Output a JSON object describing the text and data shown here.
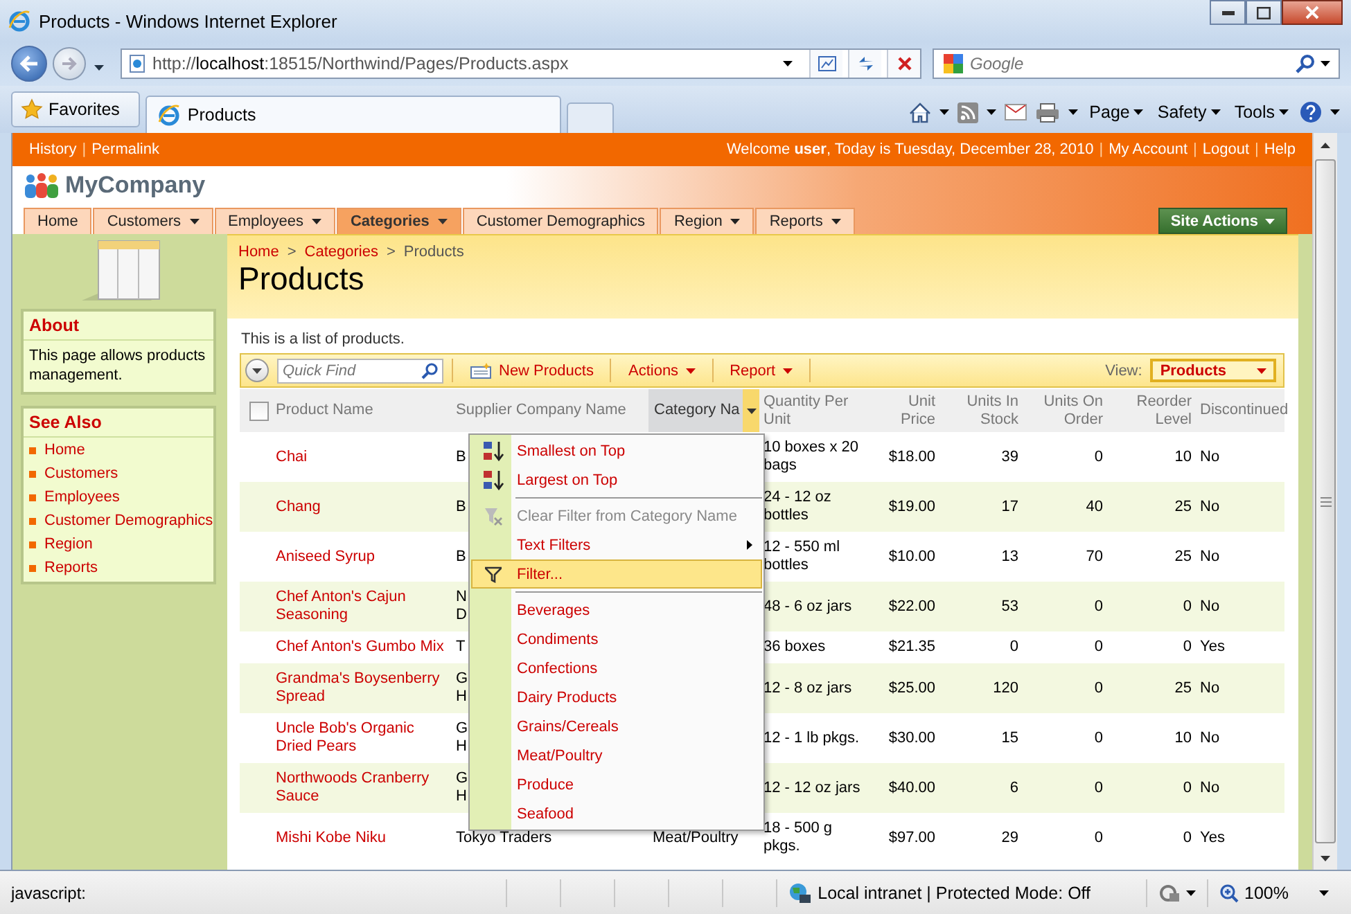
{
  "browser": {
    "title": "Products - Windows Internet Explorer",
    "address": "http://**localhost**:18515/Northwind/Pages/Products.aspx",
    "search_placeholder": "Google",
    "favorites": "Favorites",
    "tab": "Products",
    "commands": [
      "Page",
      "Safety",
      "Tools"
    ]
  },
  "top_links": [
    "History",
    "Permalink"
  ],
  "link_separator": "|",
  "breadcrumb_separator": ">",
  "welcome": "Welcome **user**, Today is Tuesday, December 28, 2010",
  "account_links": [
    "My Account",
    "Logout",
    "Help"
  ],
  "brand": "MyCompany",
  "nav": [
    {
      "label": "Home",
      "has_menu": false,
      "selected": false
    },
    {
      "label": "Customers",
      "has_menu": true,
      "selected": false
    },
    {
      "label": "Employees",
      "has_menu": true,
      "selected": false
    },
    {
      "label": "Categories",
      "has_menu": true,
      "selected": true
    },
    {
      "label": "Customer Demographics",
      "has_menu": false,
      "selected": false
    },
    {
      "label": "Region",
      "has_menu": true,
      "selected": false
    },
    {
      "label": "Reports",
      "has_menu": true,
      "selected": false
    }
  ],
  "site_actions": "Site Actions",
  "sidebar": {
    "about": {
      "title": "About",
      "text": "This page allows products management."
    },
    "see_also": {
      "title": "See Also",
      "links": [
        "Home",
        "Customers",
        "Employees",
        "Customer Demographics",
        "Region",
        "Reports"
      ]
    }
  },
  "breadcrumb": [
    {
      "label": "Home",
      "kind": "link"
    },
    {
      "label": "Categories",
      "kind": "link"
    },
    {
      "label": "Products",
      "kind": "current"
    }
  ],
  "page_title": "Products",
  "description": "This is a list of products.",
  "toolbar": {
    "quick_find_placeholder": "Quick Find",
    "buttons": [
      {
        "label": "New Products",
        "kind": "new"
      },
      {
        "label": "Actions",
        "kind": "menu"
      },
      {
        "label": "Report",
        "kind": "menu"
      }
    ],
    "view_label": "View:",
    "view": "Products"
  },
  "table": {
    "select_all_checked": false,
    "columns": [
      {
        "label": "Product Name",
        "kind": "text",
        "menu_open": false
      },
      {
        "label": "Supplier Company Name",
        "kind": "text",
        "menu_open": false
      },
      {
        "label": "Category Na",
        "kind": "text",
        "menu_open": true
      },
      {
        "label": "Quantity Per Unit",
        "kind": "text",
        "menu_open": false
      },
      {
        "label": "Unit Price",
        "kind": "number",
        "menu_open": false
      },
      {
        "label": "Units In Stock",
        "kind": "number",
        "menu_open": false
      },
      {
        "label": "Units On Order",
        "kind": "number",
        "menu_open": false
      },
      {
        "label": "Reorder Level",
        "kind": "number",
        "menu_open": false
      },
      {
        "label": "Discontinued",
        "kind": "text",
        "menu_open": false
      }
    ],
    "rows": [
      {
        "cells": [
          "Chai",
          "B",
          "",
          "10 boxes x 20 bags",
          "$18.00",
          "39",
          "0",
          "10",
          "No"
        ]
      },
      {
        "cells": [
          "Chang",
          "B",
          "",
          "24 - 12 oz bottles",
          "$19.00",
          "17",
          "40",
          "25",
          "No"
        ]
      },
      {
        "cells": [
          "Aniseed Syrup",
          "B",
          "",
          "12 - 550 ml bottles",
          "$10.00",
          "13",
          "70",
          "25",
          "No"
        ]
      },
      {
        "cells": [
          "Chef Anton's Cajun Seasoning",
          "N\nD",
          "",
          "48 - 6 oz jars",
          "$22.00",
          "53",
          "0",
          "0",
          "No"
        ]
      },
      {
        "cells": [
          "Chef Anton's Gumbo Mix",
          "T",
          "",
          "36 boxes",
          "$21.35",
          "0",
          "0",
          "0",
          "Yes"
        ]
      },
      {
        "cells": [
          "Grandma's Boysenberry Spread",
          "G\nH",
          "",
          "12 - 8 oz jars",
          "$25.00",
          "120",
          "0",
          "25",
          "No"
        ]
      },
      {
        "cells": [
          "Uncle Bob's Organic Dried Pears",
          "G\nH",
          "",
          "12 - 1 lb pkgs.",
          "$30.00",
          "15",
          "0",
          "10",
          "No"
        ]
      },
      {
        "cells": [
          "Northwoods Cranberry Sauce",
          "G\nH",
          "",
          "12 - 12 oz jars",
          "$40.00",
          "6",
          "0",
          "0",
          "No"
        ]
      },
      {
        "cells": [
          "Mishi Kobe Niku",
          "Tokyo Traders",
          "Meat/Poultry",
          "18 - 500 g pkgs.",
          "$97.00",
          "29",
          "0",
          "0",
          "Yes"
        ]
      }
    ]
  },
  "column_menu": [
    {
      "label": "Smallest on Top",
      "kind": "sort-asc",
      "disabled": false,
      "selected": false
    },
    {
      "label": "Largest on Top",
      "kind": "sort-desc",
      "disabled": false,
      "selected": false
    },
    {
      "kind": "separator"
    },
    {
      "label": "Clear Filter from Category Name",
      "kind": "clear-filter",
      "disabled": true,
      "selected": false
    },
    {
      "label": "Text Filters",
      "kind": "submenu",
      "disabled": false,
      "selected": false
    },
    {
      "label": "Filter...",
      "kind": "filter",
      "disabled": false,
      "selected": true
    },
    {
      "kind": "separator"
    },
    {
      "label": "Beverages",
      "kind": "value",
      "disabled": false,
      "selected": false
    },
    {
      "label": "Condiments",
      "kind": "value",
      "disabled": false,
      "selected": false
    },
    {
      "label": "Confections",
      "kind": "value",
      "disabled": false,
      "selected": false
    },
    {
      "label": "Dairy Products",
      "kind": "value",
      "disabled": false,
      "selected": false
    },
    {
      "label": "Grains/Cereals",
      "kind": "value",
      "disabled": false,
      "selected": false
    },
    {
      "label": "Meat/Poultry",
      "kind": "value",
      "disabled": false,
      "selected": false
    },
    {
      "label": "Produce",
      "kind": "value",
      "disabled": false,
      "selected": false
    },
    {
      "label": "Seafood",
      "kind": "value",
      "disabled": false,
      "selected": false
    }
  ],
  "status": {
    "text": "javascript:",
    "zone": "Local intranet | Protected Mode: Off",
    "zoom": "100%"
  }
}
